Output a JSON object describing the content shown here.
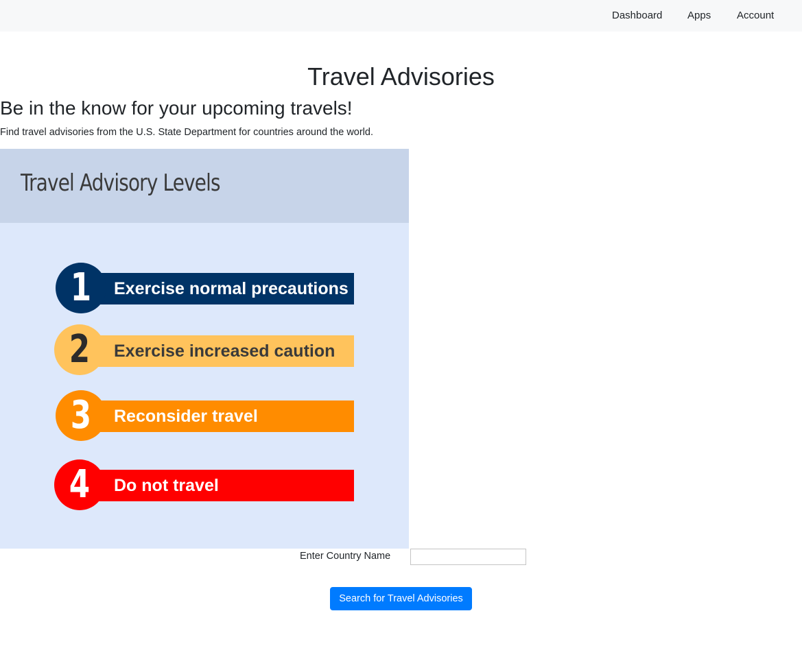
{
  "nav": {
    "items": [
      {
        "label": "Dashboard"
      },
      {
        "label": "Apps"
      },
      {
        "label": "Account"
      }
    ]
  },
  "main": {
    "title": "Travel Advisories",
    "subtitle": "Be in the know for your upcoming travels!",
    "description": "Find travel advisories from the U.S. State Department for countries around the world."
  },
  "graphic": {
    "title": "Travel Advisory Levels",
    "levels": [
      {
        "number": "1",
        "label": "Exercise normal precautions",
        "color": "#003366",
        "number_color": "#ffffff",
        "label_color": "#ffffff"
      },
      {
        "number": "2",
        "label": "Exercise increased caution",
        "color": "#ffc35c",
        "number_color": "#2b2b2b",
        "label_color": "#3a3a3a"
      },
      {
        "number": "3",
        "label": "Reconsider travel",
        "color": "#ff8c00",
        "number_color": "#ffffff",
        "label_color": "#ffffff"
      },
      {
        "number": "4",
        "label": "Do not travel",
        "color": "#ff0000",
        "number_color": "#ffffff",
        "label_color": "#ffffff"
      }
    ]
  },
  "form": {
    "country_label": "Enter Country Name",
    "country_value": "",
    "country_placeholder": "",
    "search_label": "Search for Travel Advisories"
  },
  "colors": {
    "primary": "#007bff",
    "navbar_bg": "#f7f8f9"
  }
}
